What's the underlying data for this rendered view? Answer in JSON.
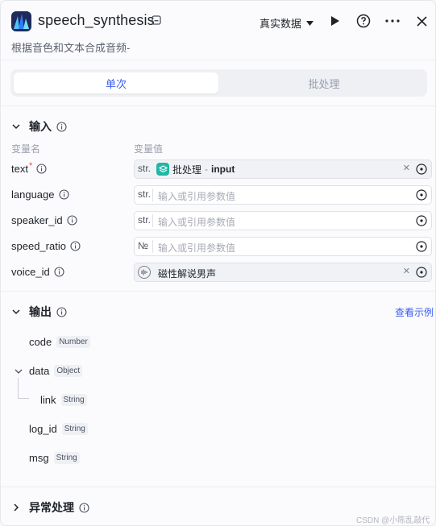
{
  "header": {
    "title": "speech_synthesis",
    "description": "根据音色和文本合成音频-",
    "data_source": "真实数据"
  },
  "tabs": [
    {
      "label": "单次",
      "active": true
    },
    {
      "label": "批处理",
      "active": false
    }
  ],
  "input_section": {
    "title": "输入",
    "col_name": "变量名",
    "col_value": "变量值",
    "rows": [
      {
        "name": "text",
        "required": "*",
        "type": "str.",
        "ref_source": "批处理",
        "ref_sep": "-",
        "ref_var": "input"
      },
      {
        "name": "language",
        "type": "str.",
        "placeholder": "输入或引用参数值"
      },
      {
        "name": "speaker_id",
        "type": "str.",
        "placeholder": "输入或引用参数值"
      },
      {
        "name": "speed_ratio",
        "type": "№",
        "placeholder": "输入或引用参数值"
      },
      {
        "name": "voice_id",
        "value": "磁性解说男声"
      }
    ]
  },
  "output_section": {
    "title": "输出",
    "view_example": "查看示例",
    "fields": [
      {
        "name": "code",
        "type": "Number"
      },
      {
        "name": "data",
        "type": "Object"
      },
      {
        "name": "link",
        "type": "String"
      },
      {
        "name": "log_id",
        "type": "String"
      },
      {
        "name": "msg",
        "type": "String"
      }
    ]
  },
  "exception_section": {
    "title": "异常处理"
  },
  "watermark": "CSDN @小陈乱敲代码",
  "colors": {
    "accent": "#3a5bf0",
    "required": "#f04848",
    "ref_icon": "#1fb7a5"
  }
}
